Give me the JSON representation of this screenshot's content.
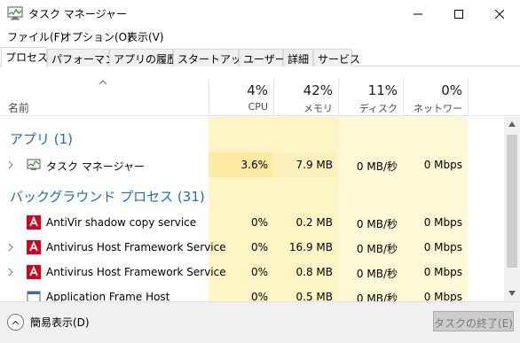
{
  "window": {
    "title": "タスク マネージャー",
    "icon": "task-manager-icon",
    "controls": {
      "minimize": "minimize-icon",
      "maximize": "maximize-icon",
      "close": "close-icon"
    }
  },
  "menu": [
    {
      "label": "ファイル(F)"
    },
    {
      "label": "オプション(O)"
    },
    {
      "label": "表示(V)"
    }
  ],
  "tabs": [
    {
      "label": "プロセス",
      "active": true
    },
    {
      "label": "パフォーマンス"
    },
    {
      "label": "アプリの履歴"
    },
    {
      "label": "スタートアップ"
    },
    {
      "label": "ユーザー"
    },
    {
      "label": "詳細"
    },
    {
      "label": "サービス"
    }
  ],
  "columns": {
    "name": "名前",
    "cpu": {
      "percent": "4%",
      "label": "CPU"
    },
    "memory": {
      "percent": "42%",
      "label": "メモリ"
    },
    "disk": {
      "percent": "11%",
      "label": "ディスク"
    },
    "network": {
      "percent": "0%",
      "label": "ネットワーク"
    }
  },
  "groups": {
    "apps": "アプリ (1)",
    "background": "バックグラウンド プロセス (31)"
  },
  "rows": [
    {
      "name": "タスク マネージャー",
      "cpu": "3.6%",
      "memory": "7.9 MB",
      "disk": "0 MB/秒",
      "network": "0 Mbps",
      "icon": "task-manager-icon"
    },
    {
      "name": "AntiVir shadow copy service",
      "cpu": "0%",
      "memory": "0.2 MB",
      "disk": "0 MB/秒",
      "network": "0 Mbps",
      "icon": "avira-icon"
    },
    {
      "name": "Antivirus Host Framework Service",
      "cpu": "0%",
      "memory": "16.9 MB",
      "disk": "0 MB/秒",
      "network": "0 Mbps",
      "icon": "avira-icon"
    },
    {
      "name": "Antivirus Host Framework Service",
      "cpu": "0%",
      "memory": "0.8 MB",
      "disk": "0 MB/秒",
      "network": "0 Mbps",
      "icon": "avira-icon"
    },
    {
      "name": "Application Frame Host",
      "cpu": "0%",
      "memory": "0.5 MB",
      "disk": "0 MB/秒",
      "network": "0 Mbps",
      "icon": "app-frame-icon"
    }
  ],
  "footer": {
    "fewer_details": "簡易表示(D)",
    "end_task": "タスクの終了(E)"
  },
  "colors": {
    "group_header": "#1c6bb5",
    "heat_band": "#fff4c4",
    "row_highlight": "#ffe9a3"
  }
}
